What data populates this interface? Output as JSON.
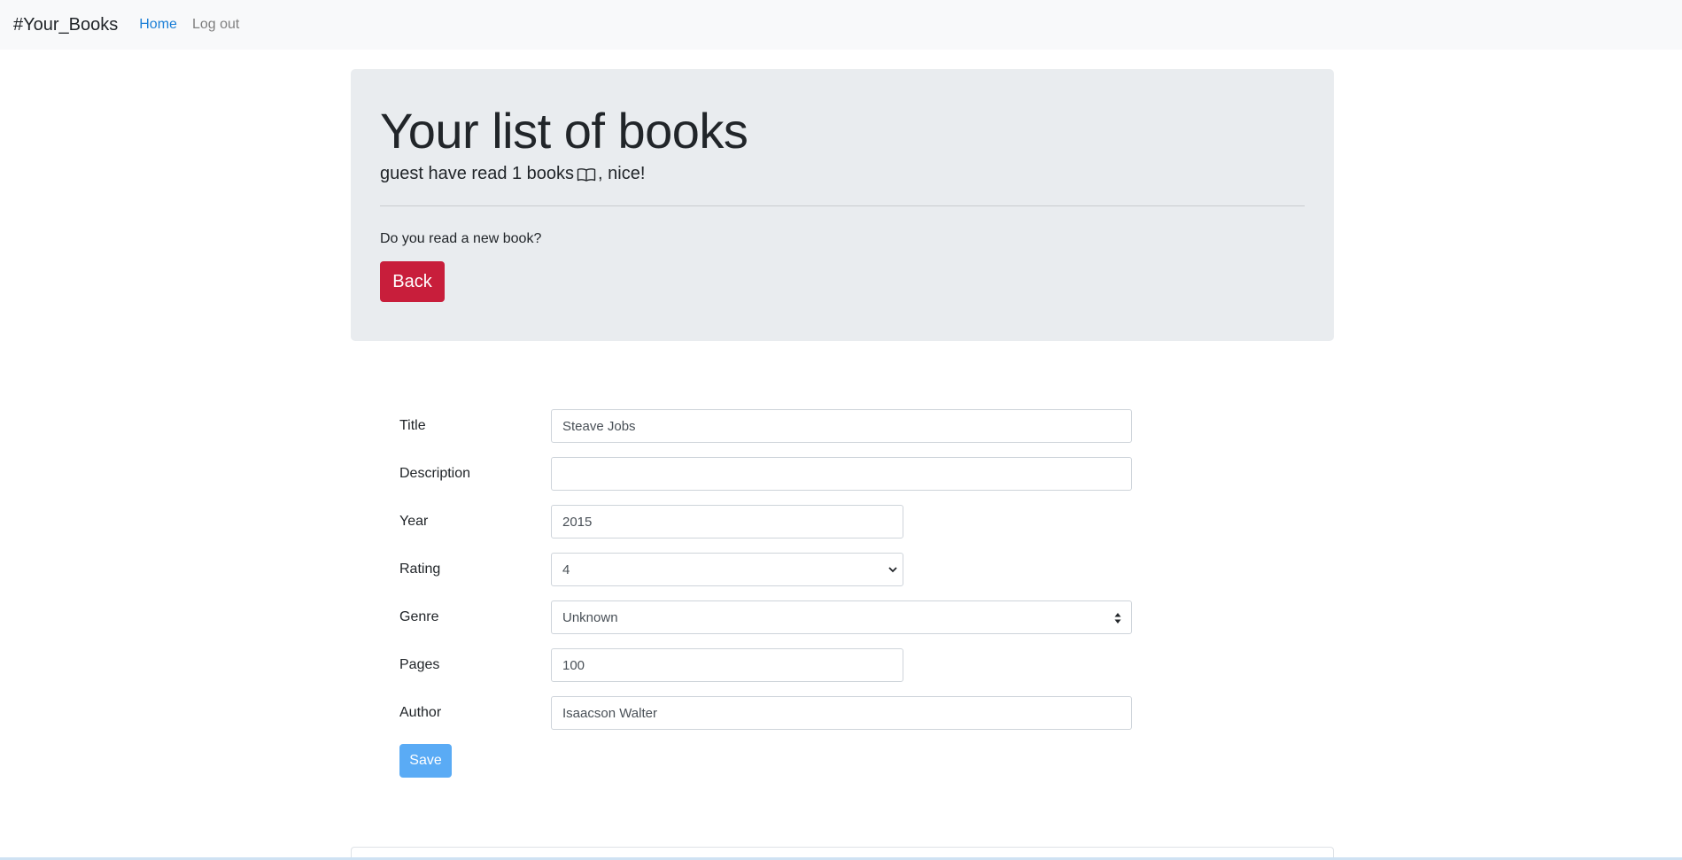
{
  "navbar": {
    "brand": "#Your_Books",
    "links": [
      {
        "label": "Home",
        "active": true
      },
      {
        "label": "Log out",
        "active": false
      }
    ]
  },
  "jumbotron": {
    "title": "Your list of books",
    "lead_before": "guest have read 1 books",
    "lead_icon": "book-icon",
    "lead_after": ", nice!",
    "question": "Do you read a new book?",
    "back_label": "Back"
  },
  "form": {
    "fields": [
      {
        "label": "Title",
        "value": "Steave Jobs"
      },
      {
        "label": "Description",
        "value": ""
      },
      {
        "label": "Year",
        "value": "2015"
      },
      {
        "label": "Rating",
        "value": "4"
      },
      {
        "label": "Genre",
        "value": "Unknown"
      },
      {
        "label": "Pages",
        "value": "100"
      },
      {
        "label": "Author",
        "value": "Isaacson Walter"
      }
    ],
    "save_label": "Save"
  },
  "colors": {
    "accent_link": "#1a7ed6",
    "back_button": "#c81e3b",
    "save_button": "#5aabf5",
    "jumbotron_bg": "#e9ecef"
  }
}
